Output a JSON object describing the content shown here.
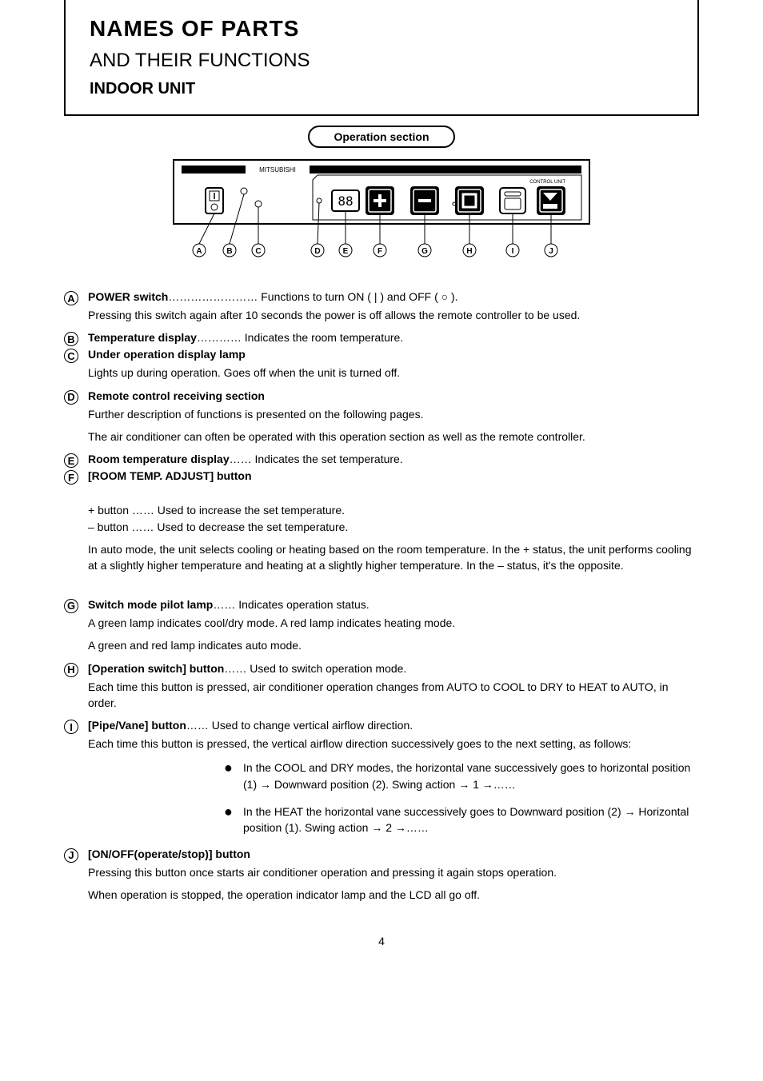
{
  "title": {
    "line1": "NAMES OF PARTS",
    "line2": "AND THEIR FUNCTIONS",
    "line3": "INDOOR UNIT"
  },
  "section_label": "Operation section",
  "pointer_labels": [
    "A",
    "B",
    "C",
    "D",
    "E",
    "F",
    "G",
    "H",
    "I",
    "J"
  ],
  "panel": {
    "brand": "MITSUBISHI",
    "control": "CONTROL UNIT"
  },
  "items": {
    "A": {
      "term": "POWER switch",
      "paren": "…………………… Functions to turn ON (  |  ) and OFF ( ○ ).",
      "desc": "Pressing this switch again after 10 seconds the power is off allows the remote controller to be used."
    },
    "B": {
      "term": "Temperature display",
      "paren": "………… Indicates the room temperature.",
      "desc": ""
    },
    "C": {
      "term": "Under operation display lamp",
      "paren": "",
      "desc": "Lights up during operation. Goes off when the unit is turned off.",
      "tight": true
    },
    "D": {
      "term": "Remote control receiving section",
      "paren": "",
      "desc": "Further description of functions is presented on the following pages.",
      "desc2": "The air conditioner can often be operated with this operation section as well as the remote controller.",
      "tight": true
    },
    "E": {
      "term": "Room temperature display",
      "paren": "…… Indicates the set temperature.",
      "desc": ""
    },
    "F": {
      "term": "[ROOM TEMP. ADJUST] button",
      "paren": "",
      "desc": "+  button …… Used to increase the set temperature.\n–  button …… Used to decrease the set temperature.",
      "desc2": "In auto mode, the unit selects cooling or heating based on the room temperature. In the + status, the unit performs cooling at a slightly higher temperature and heating at a slightly higher temperature. In the – status, it's the opposite."
    },
    "G": {
      "term": "Switch mode pilot lamp",
      "paren": "…… Indicates operation status.",
      "desc": "A green lamp indicates cool/dry mode. A red lamp indicates heating mode.",
      "desc2": "A green and red lamp indicates auto mode.",
      "tight": true
    },
    "H": {
      "term": "[Operation switch] button",
      "paren": "…… Used to switch operation mode.",
      "desc": "Each time this button is pressed, air conditioner operation changes from AUTO to COOL to DRY to HEAT to AUTO, in order.",
      "tight": true
    },
    "I": {
      "term": "[Pipe/Vane] button",
      "paren": "…… Used to change vertical airflow direction.",
      "desc": "Each time this button is pressed, the vertical airflow direction successively goes to the next setting, as follows:",
      "tight": true,
      "bullets": [
        "In the COOL and DRY modes, the horizontal vane successively goes to horizontal position (1) →  Downward position (2). Swing action → 1 →……",
        "In the HEAT the horizontal vane successively goes to Downward position (2) → Horizontal position (1). Swing action → 2 →……"
      ]
    },
    "J": {
      "term": "[ON/OFF(operate/stop)] button",
      "paren": "",
      "desc": "Pressing this button once starts air conditioner operation and pressing it again stops operation.",
      "desc2": "When operation is stopped, the operation indicator lamp and the LCD all go off.",
      "tight": true
    }
  },
  "page_number": "4"
}
